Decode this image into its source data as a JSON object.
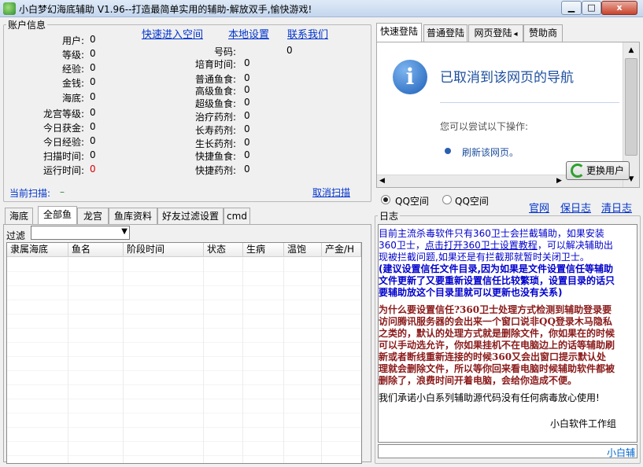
{
  "window": {
    "title": "小白梦幻海底辅助 V1.96--打造最简单实用的辅助-解放双手,愉快游戏!",
    "close": "x"
  },
  "account": {
    "group_label": "账户信息",
    "links": [
      "快速进入空间",
      "本地设置",
      "联系我们"
    ],
    "left_rows": [
      {
        "label": "用户:",
        "value": "0"
      },
      {
        "label": "等级:",
        "value": "0"
      },
      {
        "label": "经验:",
        "value": "0"
      },
      {
        "label": "金钱:",
        "value": "0"
      },
      {
        "label": "海底:",
        "value": "0"
      },
      {
        "label": "龙宫等级:",
        "value": "0"
      },
      {
        "label": "今日获金:",
        "value": "0"
      },
      {
        "label": "今日经验:",
        "value": "0"
      },
      {
        "label": "扫描时间:",
        "value": "0"
      },
      {
        "label": "运行时间:",
        "value": "0"
      }
    ],
    "number_label": "号码:",
    "number_value": "0",
    "right_rows": [
      {
        "label": "培育时间:",
        "value": "0"
      },
      {
        "label": "普通鱼食:",
        "value": "0"
      },
      {
        "label": "高级鱼食:",
        "value": "0"
      },
      {
        "label": "超级鱼食:",
        "value": "0"
      },
      {
        "label": "治疗药剂:",
        "value": "0"
      },
      {
        "label": "长寿药剂:",
        "value": "0"
      },
      {
        "label": "生长药剂:",
        "value": "0"
      },
      {
        "label": "快捷鱼食:",
        "value": "0"
      },
      {
        "label": "快捷药剂:",
        "value": "0"
      }
    ],
    "scan_label": "当前扫描:",
    "scan_value": "–",
    "cancel_scan": "取消扫描"
  },
  "fish_tabs": [
    "海底",
    "全部鱼",
    "龙宫",
    "鱼库资料",
    "好友过滤设置",
    "cmd"
  ],
  "filter": {
    "label": "过滤",
    "value": ""
  },
  "table": {
    "columns": [
      "隶属海底",
      "鱼名",
      "阶段时间",
      "状态",
      "生病",
      "温饱",
      "产金/H"
    ]
  },
  "login_tabs": [
    "快速登陆",
    "普通登陆",
    "网页登陆",
    "赞助商"
  ],
  "browser": {
    "heading": "已取消到该网页的导航",
    "try_text": "您可以尝试以下操作:",
    "refresh_link": "刷新该网页。"
  },
  "change_user": "更换用户",
  "qq_options": [
    "QQ空间",
    "QQ空间"
  ],
  "official_links": [
    "官网",
    "保日志",
    "清日志"
  ],
  "log": {
    "group_label": "日志",
    "p1_a": "目前主流杀毒软件只有360卫士会拦截辅助，如果安装360卫士，",
    "p1_link": "点击打开360卫士设置教程",
    "p1_b": "，可以解决辅助出现被拦截问题,如果还是有拦截那就暂时关闭卫士。",
    "p2": "(建议设置信任文件目录,因为如果是文件设置信任等辅助文件更新了又要重新设置信任比较繁琐，设置目录的话只要辅助放这个目录里就可以更新也没有关系)",
    "p3": "为什么要设置信任?360卫士处理方式检测到辅助登录要访问腾讯服务器的会出来一个窗口说非QQ登录木马隐私之类的，默认的处理方式就是删除文件，你如果在的时候可以手动选允许，你如果挂机不在电脑边上的话等辅助刷新或者断线重新连接的时候360又会出窗口提示默认处理就会删除文件，所以等你回来看电脑时候辅助软件都被删除了，浪费时间开着电脑，会给你造成不便。",
    "p4": "我们承诺小白系列辅助源代码没有任何病毒放心使用!",
    "p5": "小白软件工作组",
    "input_text": "小白辅"
  },
  "colors": {
    "link": "#0033cc",
    "log_blue": "#0000cc",
    "log_red": "#8b1a1a",
    "accent_red": "#d40000"
  }
}
